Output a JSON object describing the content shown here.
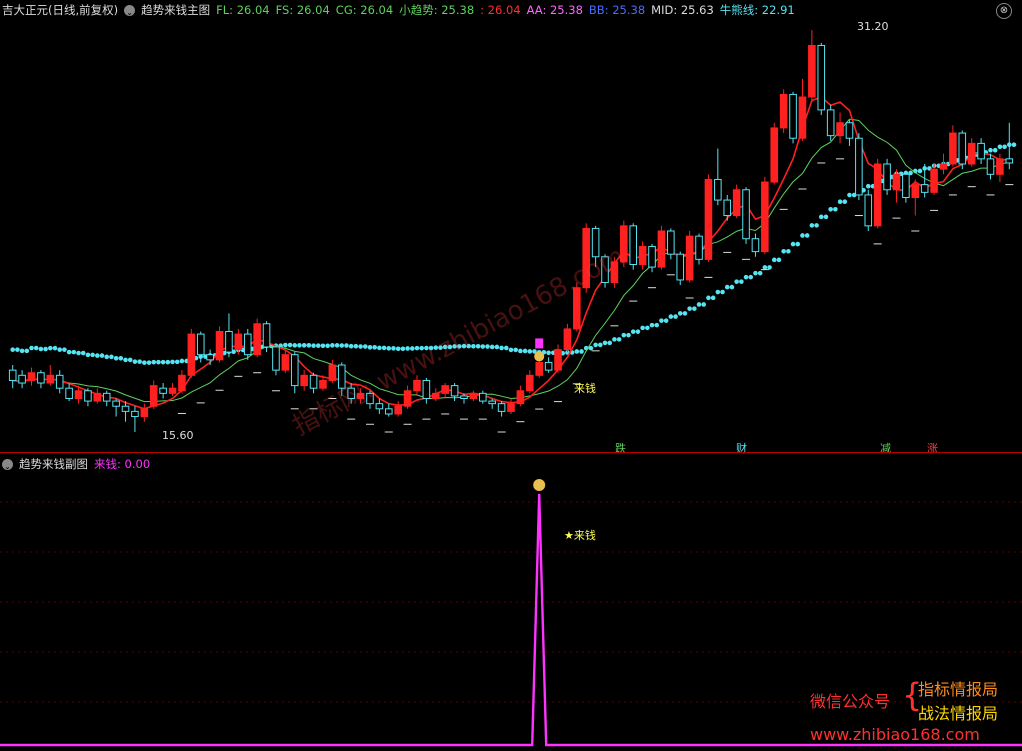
{
  "main_header": {
    "stock": "吉大正元(日线,前复权)",
    "indicator": "趋势来钱主图",
    "fl": "FL: 26.04",
    "fs": "FS: 26.04",
    "cg": "CG: 26.04",
    "trend": "小趋势: 25.38",
    "red_val": ": 26.04",
    "aa": "AA: 25.38",
    "bb": "BB: 25.38",
    "mid": "MID: 25.63",
    "bull": "牛熊线: 22.91"
  },
  "sub_header": {
    "indicator": "趋势来钱副图",
    "laiqian": "来钱: 0.00"
  },
  "labels": {
    "high": "31.20",
    "low": "15.60",
    "signal_main": "来钱",
    "signal_sub": "★来钱",
    "tag_die": "跌",
    "tag_cai": "财",
    "tag_jian": "减",
    "tag_zhang": "涨",
    "watermark": "指标网: www.zhibiao168.com",
    "wechat": "微信公众号",
    "brand1": "指标情报局",
    "brand2": "战法情报局",
    "site": "www.zhibiao168.com"
  },
  "colors": {
    "up": "#ff2020",
    "down": "#54e4f2",
    "fl": "#5ed15e",
    "fs": "#5ed15e",
    "cg": "#5ed15e",
    "trend": "#5ed15e",
    "aa": "#ff66ff",
    "bb": "#4a6cff",
    "bull": "#54e4f2",
    "signal": "#ff33ff"
  },
  "chart_data": {
    "type": "candlestick",
    "price_range": [
      15.6,
      31.2
    ],
    "candles": [
      {
        "o": 18.0,
        "c": 17.6,
        "h": 18.2,
        "l": 17.3
      },
      {
        "o": 17.8,
        "c": 17.5,
        "h": 18.0,
        "l": 17.3
      },
      {
        "o": 17.6,
        "c": 17.9,
        "h": 18.1,
        "l": 17.4
      },
      {
        "o": 17.9,
        "c": 17.5,
        "h": 18.0,
        "l": 17.3
      },
      {
        "o": 17.5,
        "c": 17.8,
        "h": 18.2,
        "l": 17.4
      },
      {
        "o": 17.8,
        "c": 17.3,
        "h": 18.0,
        "l": 17.1
      },
      {
        "o": 17.3,
        "c": 16.9,
        "h": 17.5,
        "l": 16.8
      },
      {
        "o": 16.9,
        "c": 17.2,
        "h": 17.4,
        "l": 16.7
      },
      {
        "o": 17.2,
        "c": 16.8,
        "h": 17.3,
        "l": 16.6
      },
      {
        "o": 16.8,
        "c": 17.1,
        "h": 17.3,
        "l": 16.7
      },
      {
        "o": 17.1,
        "c": 16.8,
        "h": 17.2,
        "l": 16.6
      },
      {
        "o": 16.8,
        "c": 16.6,
        "h": 16.9,
        "l": 16.2
      },
      {
        "o": 16.6,
        "c": 16.4,
        "h": 16.8,
        "l": 16.0
      },
      {
        "o": 16.4,
        "c": 16.2,
        "h": 16.6,
        "l": 15.6
      },
      {
        "o": 16.2,
        "c": 16.5,
        "h": 16.7,
        "l": 16.0
      },
      {
        "o": 16.6,
        "c": 17.4,
        "h": 17.6,
        "l": 16.5
      },
      {
        "o": 17.3,
        "c": 17.1,
        "h": 17.5,
        "l": 16.9
      },
      {
        "o": 17.1,
        "c": 17.3,
        "h": 17.5,
        "l": 17.0
      },
      {
        "o": 17.2,
        "c": 17.8,
        "h": 18.0,
        "l": 17.1
      },
      {
        "o": 17.8,
        "c": 19.4,
        "h": 19.6,
        "l": 17.7
      },
      {
        "o": 19.4,
        "c": 18.6,
        "h": 19.5,
        "l": 18.3
      },
      {
        "o": 18.6,
        "c": 18.4,
        "h": 18.8,
        "l": 18.2
      },
      {
        "o": 18.4,
        "c": 19.5,
        "h": 19.7,
        "l": 18.3
      },
      {
        "o": 19.5,
        "c": 18.7,
        "h": 20.2,
        "l": 18.5
      },
      {
        "o": 18.8,
        "c": 19.4,
        "h": 19.6,
        "l": 18.6
      },
      {
        "o": 19.4,
        "c": 18.6,
        "h": 19.6,
        "l": 18.4
      },
      {
        "o": 18.6,
        "c": 19.8,
        "h": 20.0,
        "l": 18.5
      },
      {
        "o": 19.8,
        "c": 18.9,
        "h": 19.9,
        "l": 18.7
      },
      {
        "o": 18.9,
        "c": 18.0,
        "h": 19.0,
        "l": 17.8
      },
      {
        "o": 18.0,
        "c": 18.6,
        "h": 18.8,
        "l": 17.9
      },
      {
        "o": 18.6,
        "c": 17.4,
        "h": 18.7,
        "l": 17.1
      },
      {
        "o": 17.4,
        "c": 17.8,
        "h": 18.0,
        "l": 17.2
      },
      {
        "o": 17.8,
        "c": 17.3,
        "h": 17.9,
        "l": 17.1
      },
      {
        "o": 17.3,
        "c": 17.6,
        "h": 17.8,
        "l": 17.2
      },
      {
        "o": 17.6,
        "c": 18.2,
        "h": 18.4,
        "l": 17.5
      },
      {
        "o": 18.2,
        "c": 17.3,
        "h": 18.3,
        "l": 17.0
      },
      {
        "o": 17.3,
        "c": 16.9,
        "h": 17.5,
        "l": 16.7
      },
      {
        "o": 16.9,
        "c": 17.1,
        "h": 17.3,
        "l": 16.7
      },
      {
        "o": 17.1,
        "c": 16.7,
        "h": 17.2,
        "l": 16.5
      },
      {
        "o": 16.7,
        "c": 16.5,
        "h": 16.9,
        "l": 16.3
      },
      {
        "o": 16.5,
        "c": 16.3,
        "h": 16.7,
        "l": 16.2
      },
      {
        "o": 16.3,
        "c": 16.6,
        "h": 16.8,
        "l": 16.2
      },
      {
        "o": 16.6,
        "c": 17.2,
        "h": 17.4,
        "l": 16.5
      },
      {
        "o": 17.2,
        "c": 17.6,
        "h": 17.8,
        "l": 17.0
      },
      {
        "o": 17.6,
        "c": 16.9,
        "h": 17.7,
        "l": 16.7
      },
      {
        "o": 16.9,
        "c": 17.1,
        "h": 17.3,
        "l": 16.8
      },
      {
        "o": 17.1,
        "c": 17.4,
        "h": 17.5,
        "l": 16.9
      },
      {
        "o": 17.4,
        "c": 17.0,
        "h": 17.5,
        "l": 16.8
      },
      {
        "o": 17.0,
        "c": 16.9,
        "h": 17.1,
        "l": 16.7
      },
      {
        "o": 16.9,
        "c": 17.1,
        "h": 17.2,
        "l": 16.8
      },
      {
        "o": 17.1,
        "c": 16.8,
        "h": 17.2,
        "l": 16.7
      },
      {
        "o": 16.8,
        "c": 16.7,
        "h": 16.9,
        "l": 16.5
      },
      {
        "o": 16.7,
        "c": 16.4,
        "h": 16.8,
        "l": 16.2
      },
      {
        "o": 16.4,
        "c": 16.7,
        "h": 16.9,
        "l": 16.3
      },
      {
        "o": 16.7,
        "c": 17.2,
        "h": 17.4,
        "l": 16.6
      },
      {
        "o": 17.2,
        "c": 17.8,
        "h": 18.0,
        "l": 17.1
      },
      {
        "o": 17.8,
        "c": 18.3,
        "h": 18.5,
        "l": 17.7
      },
      {
        "o": 18.3,
        "c": 18.0,
        "h": 18.5,
        "l": 17.9
      },
      {
        "o": 18.0,
        "c": 18.8,
        "h": 19.0,
        "l": 17.9
      },
      {
        "o": 18.8,
        "c": 19.6,
        "h": 19.8,
        "l": 18.7
      },
      {
        "o": 19.6,
        "c": 21.2,
        "h": 21.4,
        "l": 19.5
      },
      {
        "o": 21.2,
        "c": 23.5,
        "h": 23.7,
        "l": 21.0
      },
      {
        "o": 23.5,
        "c": 22.4,
        "h": 23.6,
        "l": 22.0
      },
      {
        "o": 22.4,
        "c": 21.4,
        "h": 22.5,
        "l": 21.2
      },
      {
        "o": 21.4,
        "c": 22.2,
        "h": 22.4,
        "l": 21.2
      },
      {
        "o": 22.2,
        "c": 23.6,
        "h": 23.8,
        "l": 22.0
      },
      {
        "o": 23.6,
        "c": 22.1,
        "h": 23.7,
        "l": 21.9
      },
      {
        "o": 22.1,
        "c": 22.8,
        "h": 23.0,
        "l": 21.9
      },
      {
        "o": 22.8,
        "c": 22.0,
        "h": 22.9,
        "l": 21.8
      },
      {
        "o": 22.0,
        "c": 23.4,
        "h": 23.6,
        "l": 21.9
      },
      {
        "o": 23.4,
        "c": 22.5,
        "h": 23.5,
        "l": 22.3
      },
      {
        "o": 22.5,
        "c": 21.5,
        "h": 22.6,
        "l": 21.3
      },
      {
        "o": 21.5,
        "c": 23.2,
        "h": 23.4,
        "l": 21.4
      },
      {
        "o": 23.2,
        "c": 22.3,
        "h": 23.3,
        "l": 22.1
      },
      {
        "o": 22.3,
        "c": 25.4,
        "h": 25.6,
        "l": 22.2
      },
      {
        "o": 25.4,
        "c": 24.6,
        "h": 26.6,
        "l": 24.4
      },
      {
        "o": 24.6,
        "c": 24.0,
        "h": 24.8,
        "l": 23.8
      },
      {
        "o": 24.0,
        "c": 25.0,
        "h": 25.2,
        "l": 23.9
      },
      {
        "o": 25.0,
        "c": 23.1,
        "h": 25.1,
        "l": 22.9
      },
      {
        "o": 23.1,
        "c": 22.6,
        "h": 23.3,
        "l": 22.4
      },
      {
        "o": 22.6,
        "c": 25.3,
        "h": 25.5,
        "l": 22.5
      },
      {
        "o": 25.3,
        "c": 27.4,
        "h": 27.6,
        "l": 25.2
      },
      {
        "o": 27.4,
        "c": 28.7,
        "h": 28.9,
        "l": 27.2
      },
      {
        "o": 28.7,
        "c": 27.0,
        "h": 28.8,
        "l": 26.8
      },
      {
        "o": 27.0,
        "c": 28.6,
        "h": 29.3,
        "l": 26.9
      },
      {
        "o": 28.6,
        "c": 30.6,
        "h": 31.2,
        "l": 28.4
      },
      {
        "o": 30.6,
        "c": 28.1,
        "h": 30.7,
        "l": 27.9
      },
      {
        "o": 28.1,
        "c": 27.1,
        "h": 28.3,
        "l": 26.9
      },
      {
        "o": 27.1,
        "c": 27.6,
        "h": 28.0,
        "l": 26.8
      },
      {
        "o": 27.6,
        "c": 27.0,
        "h": 27.7,
        "l": 26.7
      },
      {
        "o": 27.0,
        "c": 24.8,
        "h": 27.2,
        "l": 24.6
      },
      {
        "o": 24.8,
        "c": 23.6,
        "h": 25.0,
        "l": 23.4
      },
      {
        "o": 23.6,
        "c": 26.0,
        "h": 26.2,
        "l": 23.5
      },
      {
        "o": 26.0,
        "c": 25.0,
        "h": 26.2,
        "l": 24.8
      },
      {
        "o": 25.0,
        "c": 25.6,
        "h": 25.8,
        "l": 24.5
      },
      {
        "o": 25.6,
        "c": 24.7,
        "h": 25.7,
        "l": 24.5
      },
      {
        "o": 24.7,
        "c": 25.2,
        "h": 25.4,
        "l": 24.0
      },
      {
        "o": 25.2,
        "c": 24.9,
        "h": 26.0,
        "l": 24.7
      },
      {
        "o": 24.9,
        "c": 25.8,
        "h": 26.0,
        "l": 24.8
      },
      {
        "o": 25.8,
        "c": 26.0,
        "h": 26.4,
        "l": 25.6
      },
      {
        "o": 26.0,
        "c": 27.2,
        "h": 27.5,
        "l": 25.9
      },
      {
        "o": 27.2,
        "c": 26.0,
        "h": 27.3,
        "l": 25.8
      },
      {
        "o": 26.0,
        "c": 26.8,
        "h": 27.0,
        "l": 25.9
      },
      {
        "o": 26.8,
        "c": 26.2,
        "h": 27.0,
        "l": 26.0
      },
      {
        "o": 26.2,
        "c": 25.6,
        "h": 26.4,
        "l": 25.4
      },
      {
        "o": 25.6,
        "c": 26.2,
        "h": 26.4,
        "l": 25.3
      },
      {
        "o": 26.2,
        "c": 26.04,
        "h": 27.6,
        "l": 25.8
      }
    ],
    "signal_index": 56,
    "sub_signal": {
      "index": 56,
      "value": 1.0,
      "baseline": 0.0
    }
  }
}
